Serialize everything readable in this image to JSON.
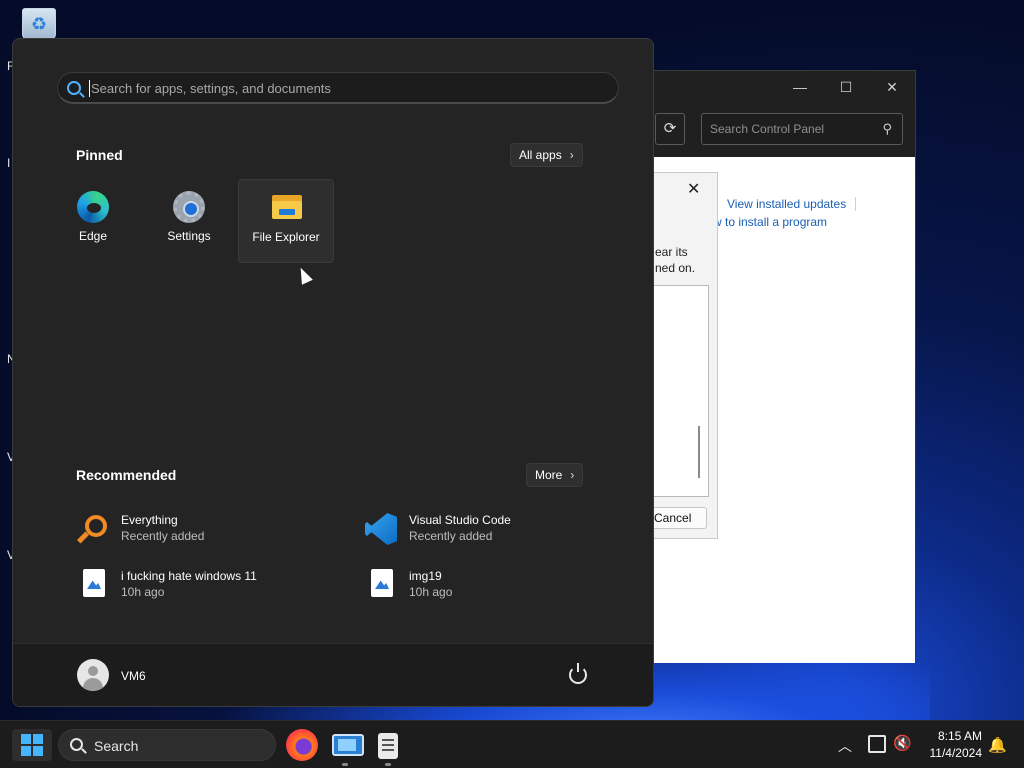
{
  "desktop": {
    "edge_letters": [
      "F",
      "I",
      "N",
      "V",
      "V"
    ]
  },
  "control_panel": {
    "minimize": "—",
    "maximize": "☐",
    "close": "✕",
    "refresh": "⟳",
    "search_placeholder": "Search Control Panel",
    "links": {
      "view_updates": "View installed updates",
      "install_program": "w to install a program"
    },
    "dialog": {
      "close": "✕",
      "text_line1": "ear its",
      "text_line2": "ned on.",
      "cancel": "Cancel"
    }
  },
  "start_menu": {
    "search_placeholder": "Search for apps, settings, and documents",
    "pinned_title": "Pinned",
    "all_apps_label": "All apps",
    "pinned": [
      {
        "label": "Edge",
        "icon": "edge-icon"
      },
      {
        "label": "Settings",
        "icon": "gear-icon"
      },
      {
        "label": "File Explorer",
        "icon": "folder-icon"
      }
    ],
    "recommended_title": "Recommended",
    "more_label": "More",
    "recommended": [
      {
        "name": "Everything",
        "sub": "Recently added",
        "icon": "search-app-icon"
      },
      {
        "name": "Visual Studio Code",
        "sub": "Recently added",
        "icon": "vscode-icon"
      },
      {
        "name": "i fucking hate windows 11",
        "sub": "10h ago",
        "icon": "image-file-icon"
      },
      {
        "name": "img19",
        "sub": "10h ago",
        "icon": "image-file-icon"
      }
    ],
    "user": "VM6"
  },
  "taskbar": {
    "search_label": "Search",
    "apps": [
      "firefox-icon",
      "remote-desktop-icon",
      "notepad-icon"
    ],
    "clock_time": "8:15 AM",
    "clock_date": "11/4/2024"
  },
  "colors": {
    "accent": "#4db2ff",
    "link": "#1a5fb4",
    "start_bg": "#242424",
    "taskbar_bg": "#1c1c1c"
  }
}
